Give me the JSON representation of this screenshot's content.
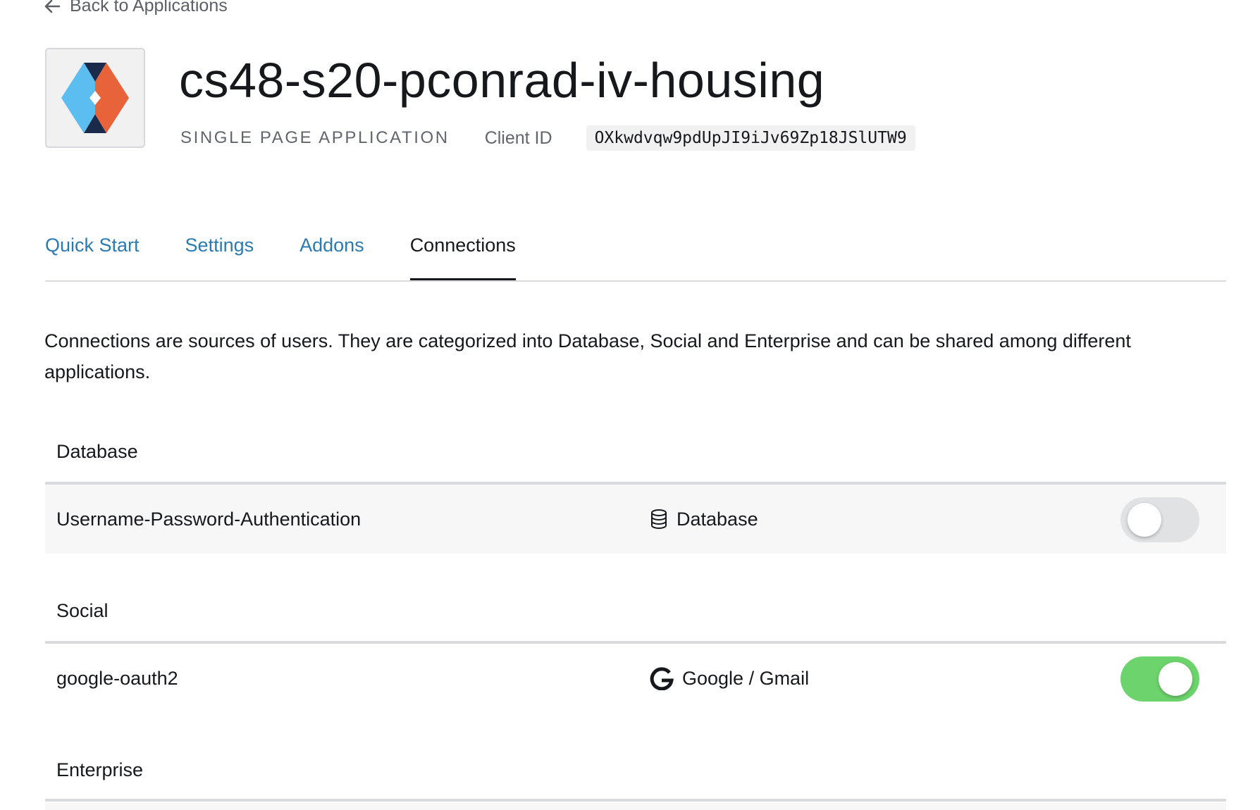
{
  "nav": {
    "back_label": "Back to Applications"
  },
  "app": {
    "name": "cs48-s20-pconrad-iv-housing",
    "type": "SINGLE PAGE APPLICATION",
    "client_id_label": "Client ID",
    "client_id": "OXkwdvqw9pdUpJI9iJv69Zp18JSlUTW9"
  },
  "tabs": [
    {
      "label": "Quick Start",
      "active": false
    },
    {
      "label": "Settings",
      "active": false
    },
    {
      "label": "Addons",
      "active": false
    },
    {
      "label": "Connections",
      "active": true
    }
  ],
  "description": "Connections are sources of users. They are categorized into Database, Social and Enterprise and can be shared among different applications.",
  "sections": {
    "database": {
      "heading": "Database",
      "connections": [
        {
          "name": "Username-Password-Authentication",
          "type_label": "Database",
          "type_icon": "database-icon",
          "enabled": false
        }
      ]
    },
    "social": {
      "heading": "Social",
      "connections": [
        {
          "name": "google-oauth2",
          "type_label": "Google / Gmail",
          "type_icon": "google-icon",
          "enabled": true
        }
      ]
    },
    "enterprise": {
      "heading": "Enterprise"
    }
  },
  "colors": {
    "tab_link": "#2b7ab0",
    "toggle_on": "#6dd36c",
    "toggle_off": "#e1e2e4",
    "logo_left": "#5bbdf0",
    "logo_right": "#e8623a",
    "logo_dark": "#1a2a4a"
  }
}
